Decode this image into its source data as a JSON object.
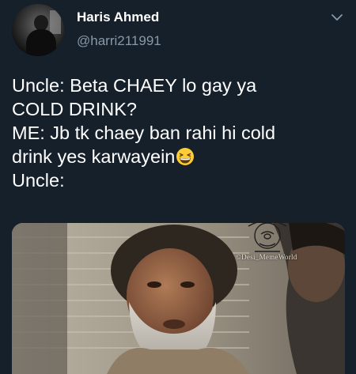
{
  "tweet": {
    "author_name": "Haris Ahmed",
    "author_handle": "@harri211991",
    "lines": [
      "Uncle: Beta CHAEY lo gay ya",
      "COLD DRINK?",
      "ME: Jb tk chaey ban rahi hi cold",
      "drink yes karwayein",
      "Uncle:"
    ],
    "emoji": "grinning-squinting-face",
    "media": {
      "type": "photo",
      "watermark_text": "©Desi_MemeWorld"
    }
  },
  "icons": {
    "menu": "chevron-down-icon"
  },
  "colors": {
    "background": "#15202b",
    "secondary_text": "#8899a6",
    "primary_text": "#ffffff"
  }
}
